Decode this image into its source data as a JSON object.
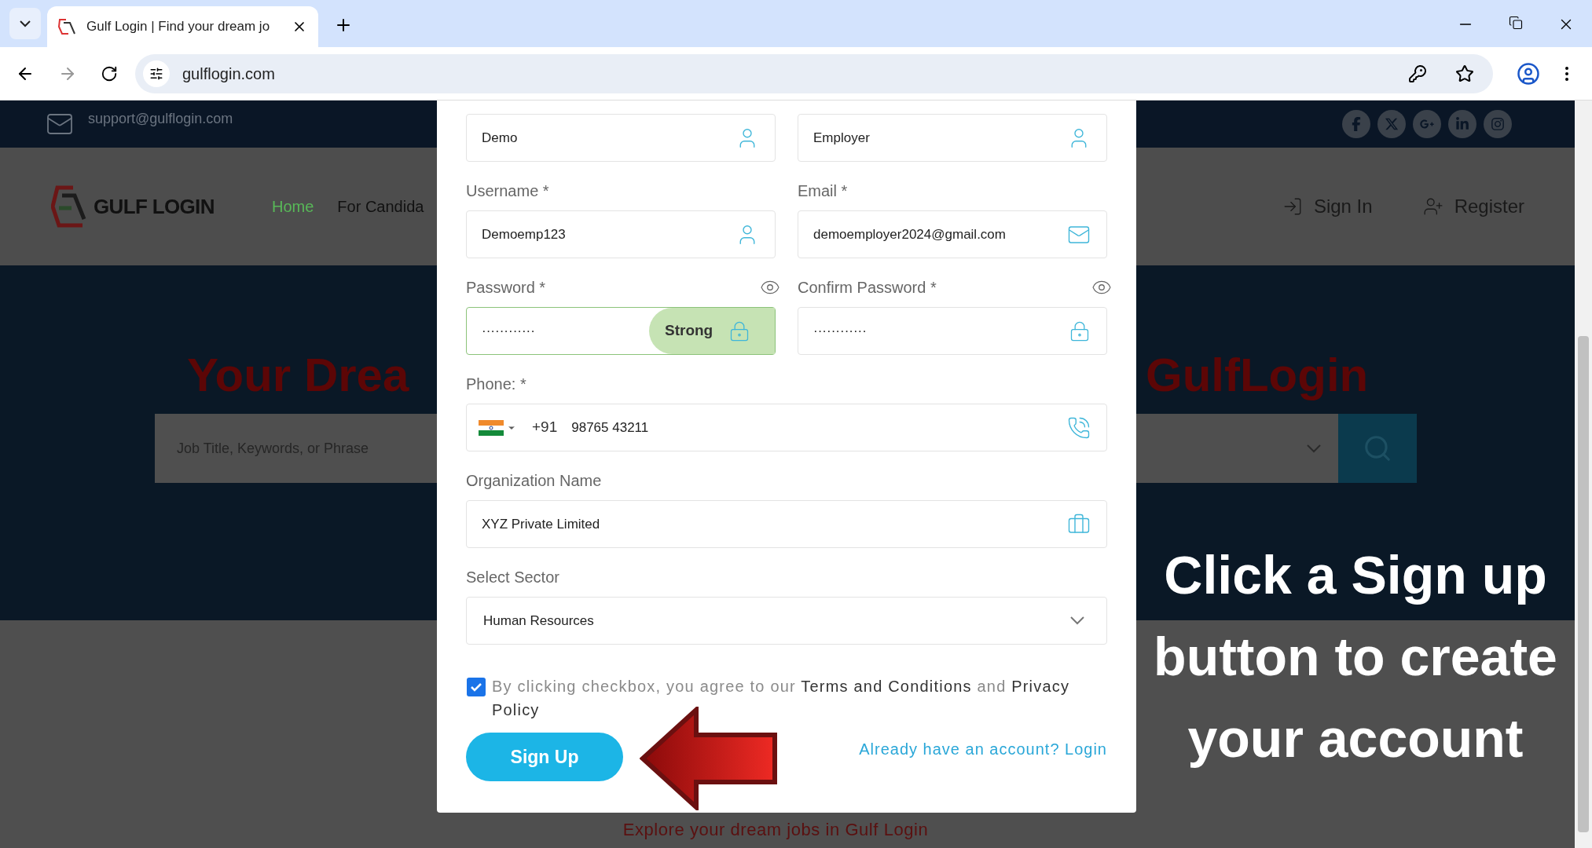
{
  "browser": {
    "tab_title": "Gulf Login | Find your dream jo",
    "url": "gulflogin.com"
  },
  "site": {
    "support_email": "support@gulflogin.com",
    "logo_text": "GULF LOGIN",
    "nav": [
      {
        "label": "Home",
        "selected": true
      },
      {
        "label": "For Candida",
        "selected": false
      }
    ],
    "header_actions": [
      {
        "label": "Sign In",
        "kind": "signin"
      },
      {
        "label": "Register",
        "kind": "register"
      }
    ],
    "hero_title_left": "Your Drea",
    "hero_title_right": "GulfLogin",
    "search_placeholder": "Job Title, Keywords, or Phrase",
    "tagline": "Explore your dream jobs in Gulf Login"
  },
  "form": {
    "first_name": "Demo",
    "last_name": "Employer",
    "username": {
      "label": "Username *",
      "value": "Demoemp123"
    },
    "email": {
      "label": "Email *",
      "value": "demoemployer2024@gmail.com"
    },
    "password": {
      "label": "Password *",
      "value": "············",
      "strength": "Strong"
    },
    "confirm_password": {
      "label": "Confirm Password *",
      "value": "············"
    },
    "phone": {
      "label": "Phone: *",
      "country_code": "+91",
      "value": "98765 43211"
    },
    "organization": {
      "label": "Organization Name",
      "value": "XYZ Private Limited"
    },
    "sector": {
      "label": "Select Sector",
      "value": "Human Resources"
    },
    "agreement": {
      "checked": true,
      "parts": [
        {
          "text": "By clicking checkbox, you agree to our ",
          "kind": "plain"
        },
        {
          "text": "Terms and Conditions",
          "kind": "link"
        },
        {
          "text": " and ",
          "kind": "plain"
        },
        {
          "text": "Privacy Policy",
          "kind": "link"
        }
      ]
    },
    "submit": "Sign Up",
    "login_link": "Already have an account? Login"
  },
  "caption": [
    "Click a Sign up",
    "button to create",
    "your account"
  ]
}
